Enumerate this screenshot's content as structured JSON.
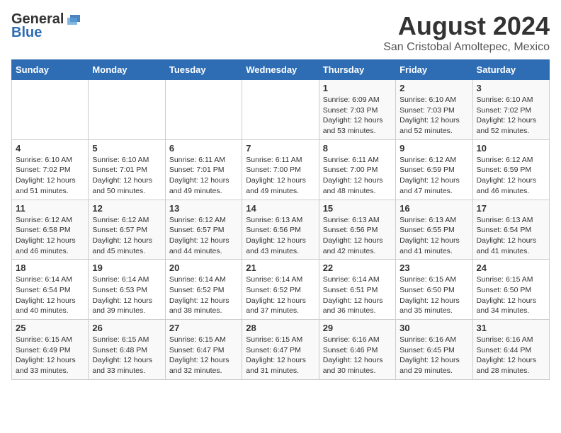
{
  "header": {
    "logo_general": "General",
    "logo_blue": "Blue",
    "month_title": "August 2024",
    "location": "San Cristobal Amoltepec, Mexico"
  },
  "days_of_week": [
    "Sunday",
    "Monday",
    "Tuesday",
    "Wednesday",
    "Thursday",
    "Friday",
    "Saturday"
  ],
  "weeks": [
    [
      {
        "day": "",
        "info": ""
      },
      {
        "day": "",
        "info": ""
      },
      {
        "day": "",
        "info": ""
      },
      {
        "day": "",
        "info": ""
      },
      {
        "day": "1",
        "info": "Sunrise: 6:09 AM\nSunset: 7:03 PM\nDaylight: 12 hours\nand 53 minutes."
      },
      {
        "day": "2",
        "info": "Sunrise: 6:10 AM\nSunset: 7:03 PM\nDaylight: 12 hours\nand 52 minutes."
      },
      {
        "day": "3",
        "info": "Sunrise: 6:10 AM\nSunset: 7:02 PM\nDaylight: 12 hours\nand 52 minutes."
      }
    ],
    [
      {
        "day": "4",
        "info": "Sunrise: 6:10 AM\nSunset: 7:02 PM\nDaylight: 12 hours\nand 51 minutes."
      },
      {
        "day": "5",
        "info": "Sunrise: 6:10 AM\nSunset: 7:01 PM\nDaylight: 12 hours\nand 50 minutes."
      },
      {
        "day": "6",
        "info": "Sunrise: 6:11 AM\nSunset: 7:01 PM\nDaylight: 12 hours\nand 49 minutes."
      },
      {
        "day": "7",
        "info": "Sunrise: 6:11 AM\nSunset: 7:00 PM\nDaylight: 12 hours\nand 49 minutes."
      },
      {
        "day": "8",
        "info": "Sunrise: 6:11 AM\nSunset: 7:00 PM\nDaylight: 12 hours\nand 48 minutes."
      },
      {
        "day": "9",
        "info": "Sunrise: 6:12 AM\nSunset: 6:59 PM\nDaylight: 12 hours\nand 47 minutes."
      },
      {
        "day": "10",
        "info": "Sunrise: 6:12 AM\nSunset: 6:59 PM\nDaylight: 12 hours\nand 46 minutes."
      }
    ],
    [
      {
        "day": "11",
        "info": "Sunrise: 6:12 AM\nSunset: 6:58 PM\nDaylight: 12 hours\nand 46 minutes."
      },
      {
        "day": "12",
        "info": "Sunrise: 6:12 AM\nSunset: 6:57 PM\nDaylight: 12 hours\nand 45 minutes."
      },
      {
        "day": "13",
        "info": "Sunrise: 6:12 AM\nSunset: 6:57 PM\nDaylight: 12 hours\nand 44 minutes."
      },
      {
        "day": "14",
        "info": "Sunrise: 6:13 AM\nSunset: 6:56 PM\nDaylight: 12 hours\nand 43 minutes."
      },
      {
        "day": "15",
        "info": "Sunrise: 6:13 AM\nSunset: 6:56 PM\nDaylight: 12 hours\nand 42 minutes."
      },
      {
        "day": "16",
        "info": "Sunrise: 6:13 AM\nSunset: 6:55 PM\nDaylight: 12 hours\nand 41 minutes."
      },
      {
        "day": "17",
        "info": "Sunrise: 6:13 AM\nSunset: 6:54 PM\nDaylight: 12 hours\nand 41 minutes."
      }
    ],
    [
      {
        "day": "18",
        "info": "Sunrise: 6:14 AM\nSunset: 6:54 PM\nDaylight: 12 hours\nand 40 minutes."
      },
      {
        "day": "19",
        "info": "Sunrise: 6:14 AM\nSunset: 6:53 PM\nDaylight: 12 hours\nand 39 minutes."
      },
      {
        "day": "20",
        "info": "Sunrise: 6:14 AM\nSunset: 6:52 PM\nDaylight: 12 hours\nand 38 minutes."
      },
      {
        "day": "21",
        "info": "Sunrise: 6:14 AM\nSunset: 6:52 PM\nDaylight: 12 hours\nand 37 minutes."
      },
      {
        "day": "22",
        "info": "Sunrise: 6:14 AM\nSunset: 6:51 PM\nDaylight: 12 hours\nand 36 minutes."
      },
      {
        "day": "23",
        "info": "Sunrise: 6:15 AM\nSunset: 6:50 PM\nDaylight: 12 hours\nand 35 minutes."
      },
      {
        "day": "24",
        "info": "Sunrise: 6:15 AM\nSunset: 6:50 PM\nDaylight: 12 hours\nand 34 minutes."
      }
    ],
    [
      {
        "day": "25",
        "info": "Sunrise: 6:15 AM\nSunset: 6:49 PM\nDaylight: 12 hours\nand 33 minutes."
      },
      {
        "day": "26",
        "info": "Sunrise: 6:15 AM\nSunset: 6:48 PM\nDaylight: 12 hours\nand 33 minutes."
      },
      {
        "day": "27",
        "info": "Sunrise: 6:15 AM\nSunset: 6:47 PM\nDaylight: 12 hours\nand 32 minutes."
      },
      {
        "day": "28",
        "info": "Sunrise: 6:15 AM\nSunset: 6:47 PM\nDaylight: 12 hours\nand 31 minutes."
      },
      {
        "day": "29",
        "info": "Sunrise: 6:16 AM\nSunset: 6:46 PM\nDaylight: 12 hours\nand 30 minutes."
      },
      {
        "day": "30",
        "info": "Sunrise: 6:16 AM\nSunset: 6:45 PM\nDaylight: 12 hours\nand 29 minutes."
      },
      {
        "day": "31",
        "info": "Sunrise: 6:16 AM\nSunset: 6:44 PM\nDaylight: 12 hours\nand 28 minutes."
      }
    ]
  ]
}
